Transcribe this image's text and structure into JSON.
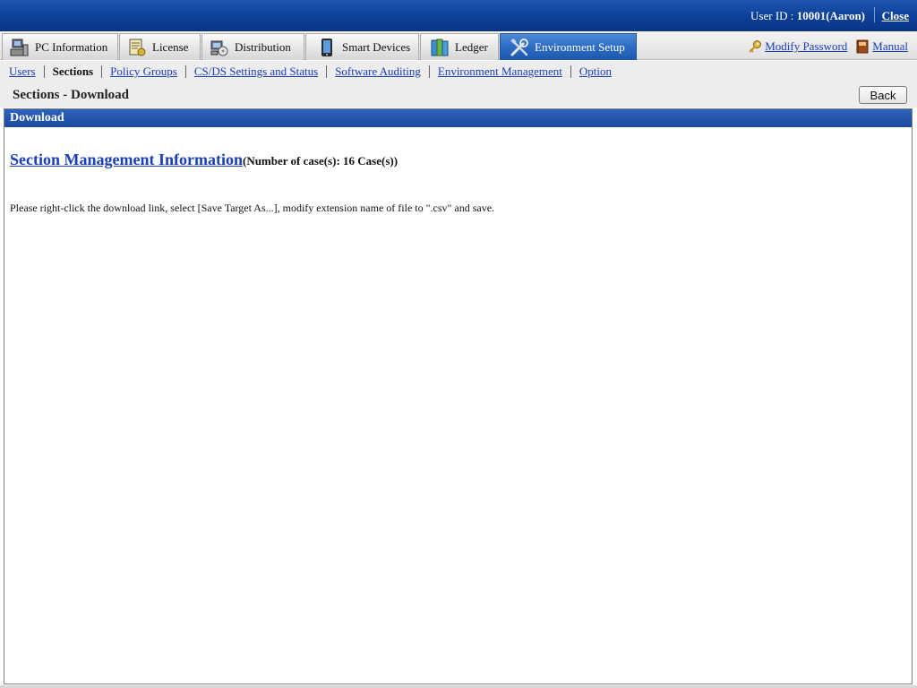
{
  "header": {
    "user_label": "User ID : ",
    "user_value": "10001(Aaron)",
    "close_label": "Close"
  },
  "tabs": [
    {
      "label": "PC Information",
      "icon": "pc-icon",
      "active": false
    },
    {
      "label": "License",
      "icon": "license-icon",
      "active": false
    },
    {
      "label": "Distribution",
      "icon": "distribution-icon",
      "active": false
    },
    {
      "label": "Smart Devices",
      "icon": "smart-device-icon",
      "active": false
    },
    {
      "label": "Ledger",
      "icon": "ledger-icon",
      "active": false
    },
    {
      "label": "Environment Setup",
      "icon": "tools-icon",
      "active": true
    }
  ],
  "right_links": {
    "modify_password": "Modify Password",
    "manual": "Manual"
  },
  "subnav": {
    "items": [
      "Users",
      "Sections",
      "Policy Groups",
      "CS/DS Settings and Status",
      "Software Auditing",
      "Environment Management",
      "Option"
    ],
    "current": "Sections"
  },
  "page": {
    "title": "Sections - Download",
    "back_label": "Back"
  },
  "panel": {
    "title": "Download",
    "link_label": "Section Management Information",
    "count_text": "(Number of case(s): 16 Case(s))",
    "note": "Please right-click the download link, select [Save Target As...], modify extension name of file to \".csv\" and save."
  },
  "colors": {
    "brand_blue": "#0c3f96",
    "active_tab": "#2d6cc3",
    "link": "#1a3fb8"
  }
}
